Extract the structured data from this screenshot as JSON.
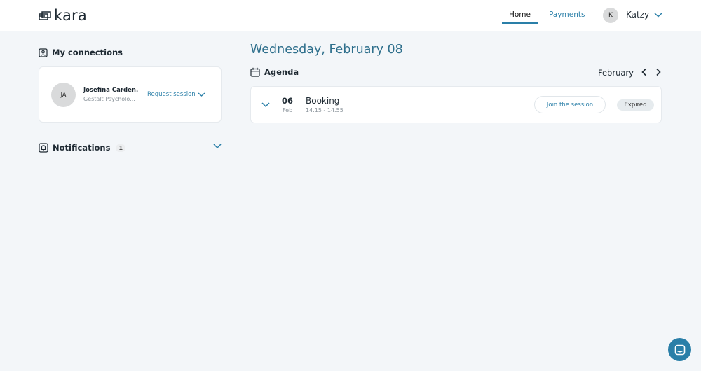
{
  "header": {
    "logo_text": "kara",
    "nav": [
      {
        "label": "Home",
        "active": true
      },
      {
        "label": "Payments",
        "active": false
      }
    ],
    "user": {
      "initial": "K",
      "name": "Katzy"
    }
  },
  "connections": {
    "title": "My connections",
    "items": [
      {
        "initials": "JA",
        "name": "Josefina Carden...",
        "role": "Gestalt Psycholo...",
        "action": "Request session"
      }
    ]
  },
  "notifications": {
    "title": "Notifications",
    "count": "1"
  },
  "main": {
    "date_heading": "Wednesday, February 08",
    "agenda_title": "Agenda",
    "month": "February",
    "events": [
      {
        "day": "06",
        "month": "Feb",
        "title": "Booking",
        "time": "14.15 - 14.55",
        "join_label": "Join the session",
        "status": "Expired"
      }
    ]
  },
  "colors": {
    "accent": "#2a7fa8",
    "heading": "#2e6f8c",
    "background": "#f3f6f9"
  }
}
